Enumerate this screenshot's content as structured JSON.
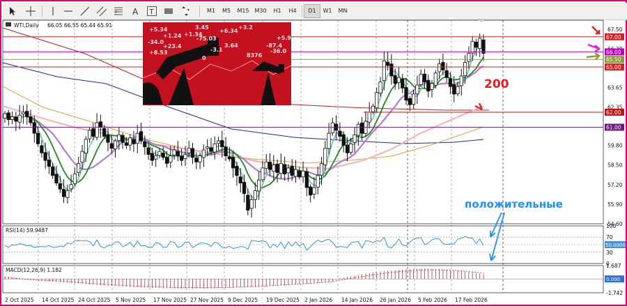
{
  "toolbar": {
    "timeframes": [
      "M1",
      "M5",
      "M15",
      "M30",
      "H1",
      "H4",
      "D1",
      "W1",
      "MN"
    ],
    "selected_timeframe": "D1"
  },
  "chart_data": [
    {
      "type": "candlestick",
      "title": "WTI,Daily",
      "ohlc_readout": "66.05 66.55 65.44 65.91",
      "x_tick_labels": [
        "2 Oct 2025",
        "14 Oct 2025",
        "24 Oct 2025",
        "5 Nov 2025",
        "17 Nov 2025",
        "27 Nov 2025",
        "9 Dec 2025",
        "19 Dec 2025",
        "2 Jan 2026",
        "14 Jan 2026",
        "26 Jan 2026",
        "5 Feb 2026",
        "17 Feb 2026"
      ],
      "y_tick_labels": [
        "67.50",
        "66.20",
        "64.90",
        "63.65",
        "62.35",
        "61.05",
        "59.80",
        "58.50",
        "57.20",
        "55.90",
        "54.60"
      ],
      "ylim": [
        54.6,
        68.1
      ],
      "closes": [
        61.9,
        61.5,
        61.7,
        61.4,
        61.8,
        62.0,
        61.7,
        61.3,
        60.6,
        59.9,
        59.3,
        58.8,
        58.4,
        57.8,
        57.3,
        56.9,
        56.4,
        56.8,
        57.2,
        57.9,
        58.6,
        59.4,
        60.2,
        60.8,
        60.4,
        61.3,
        61.0,
        60.4,
        60.0,
        59.6,
        60.1,
        60.5,
        60.0,
        59.8,
        60.3,
        59.9,
        60.6,
        60.1,
        59.7,
        59.2,
        58.8,
        59.1,
        59.4,
        59.0,
        58.6,
        59.1,
        59.5,
        59.1,
        58.8,
        59.2,
        59.6,
        59.0,
        58.7,
        59.1,
        59.5,
        59.7,
        59.4,
        59.9,
        60.1,
        59.7,
        59.1,
        58.9,
        58.3,
        57.8,
        57.3,
        56.6,
        55.5,
        56.2,
        56.8,
        57.5,
        58.3,
        58.7,
        58.2,
        58.5,
        58.0,
        58.6,
        57.9,
        58.3,
        57.8,
        58.2,
        57.7,
        58.1,
        57.0,
        56.5,
        57.0,
        57.8,
        58.6,
        59.6,
        60.6,
        61.3,
        60.8,
        60.4,
        59.8,
        59.3,
        59.9,
        60.5,
        61.2,
        60.6,
        61.4,
        62.0,
        62.4,
        63.3,
        64.0,
        65.4,
        65.1,
        64.4,
        63.9,
        64.3,
        63.6,
        62.8,
        62.5,
        63.2,
        63.8,
        64.5,
        64.0,
        63.4,
        63.9,
        64.6,
        65.2,
        64.8,
        64.3,
        63.7,
        63.2,
        63.7,
        64.4,
        65.3,
        65.9,
        66.7,
        66.3,
        66.9,
        65.9
      ],
      "horizontal_levels": [
        {
          "value": "67.00",
          "color": "#d42222"
        },
        {
          "value": "66.00",
          "color": "#c000c0"
        },
        {
          "value": "65.50",
          "color": "#8c9b37"
        },
        {
          "value": "65.00",
          "color": "#d42222"
        },
        {
          "value": "62.00",
          "color": "#c01414"
        },
        {
          "value": "61.00",
          "color": "#6a1b7a"
        }
      ],
      "annotations": [
        "200",
        "положительные"
      ],
      "inset_image": {
        "ticker_text": [
          "+5.34",
          "+1.24",
          "-34.0",
          "+23.4",
          "+8.53",
          "3.45",
          "+6.34",
          "+3.2",
          "8376",
          "-87.4",
          "-36.0",
          "+5.9",
          "+1.34",
          "-75.03",
          "3.64",
          "-3.1",
          "0"
        ]
      }
    },
    {
      "type": "line",
      "title": "RSI(14) 59.9487",
      "y_tick_labels": [
        "100",
        "70",
        "50.0000",
        "30",
        "0"
      ],
      "ylim": [
        0,
        100
      ]
    },
    {
      "type": "bar",
      "title": "MACD(12,26,9) 1.182",
      "y_tick_labels": [
        "1.687",
        "0.000",
        "-1.742"
      ],
      "ylim": [
        -1.742,
        1.687
      ]
    }
  ]
}
